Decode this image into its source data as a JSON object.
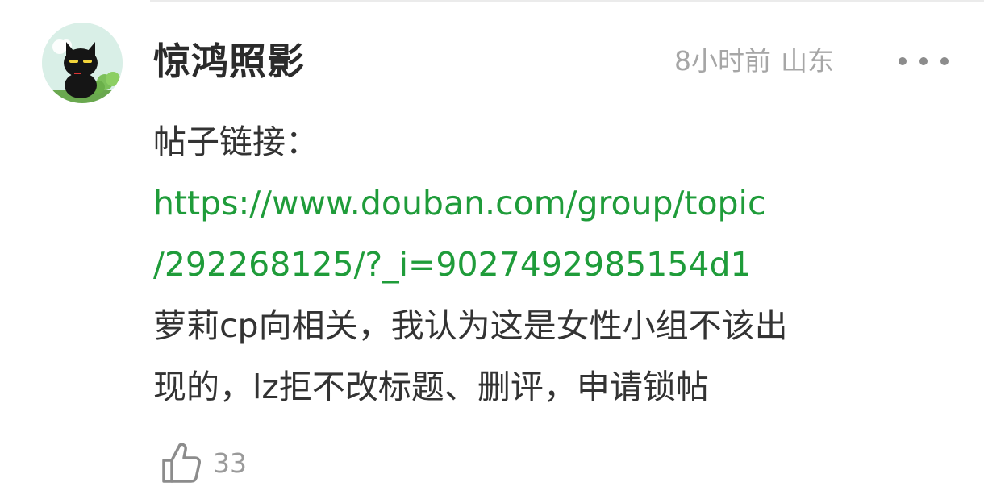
{
  "comment": {
    "author": {
      "name": "惊鸿照影",
      "avatar": "black-cat-avatar-icon"
    },
    "time": "8小时前",
    "location": "山东",
    "more_icon": "more-dots-icon",
    "body": {
      "prefix": "帖子链接：",
      "link_line1": "https://www.douban.com/group/topic",
      "link_line2": "/292268125/?_i=9027492985154d1",
      "text_line1": "萝莉cp向相关，我认为这是女性小组不该出",
      "text_line2": "现的，lz拒不改标题、删评，申请锁帖"
    },
    "likes": {
      "icon": "thumbs-up-icon",
      "count": "33"
    }
  },
  "colors": {
    "link": "#1f9c3a",
    "text": "#333333",
    "meta": "#a6a6a6"
  }
}
